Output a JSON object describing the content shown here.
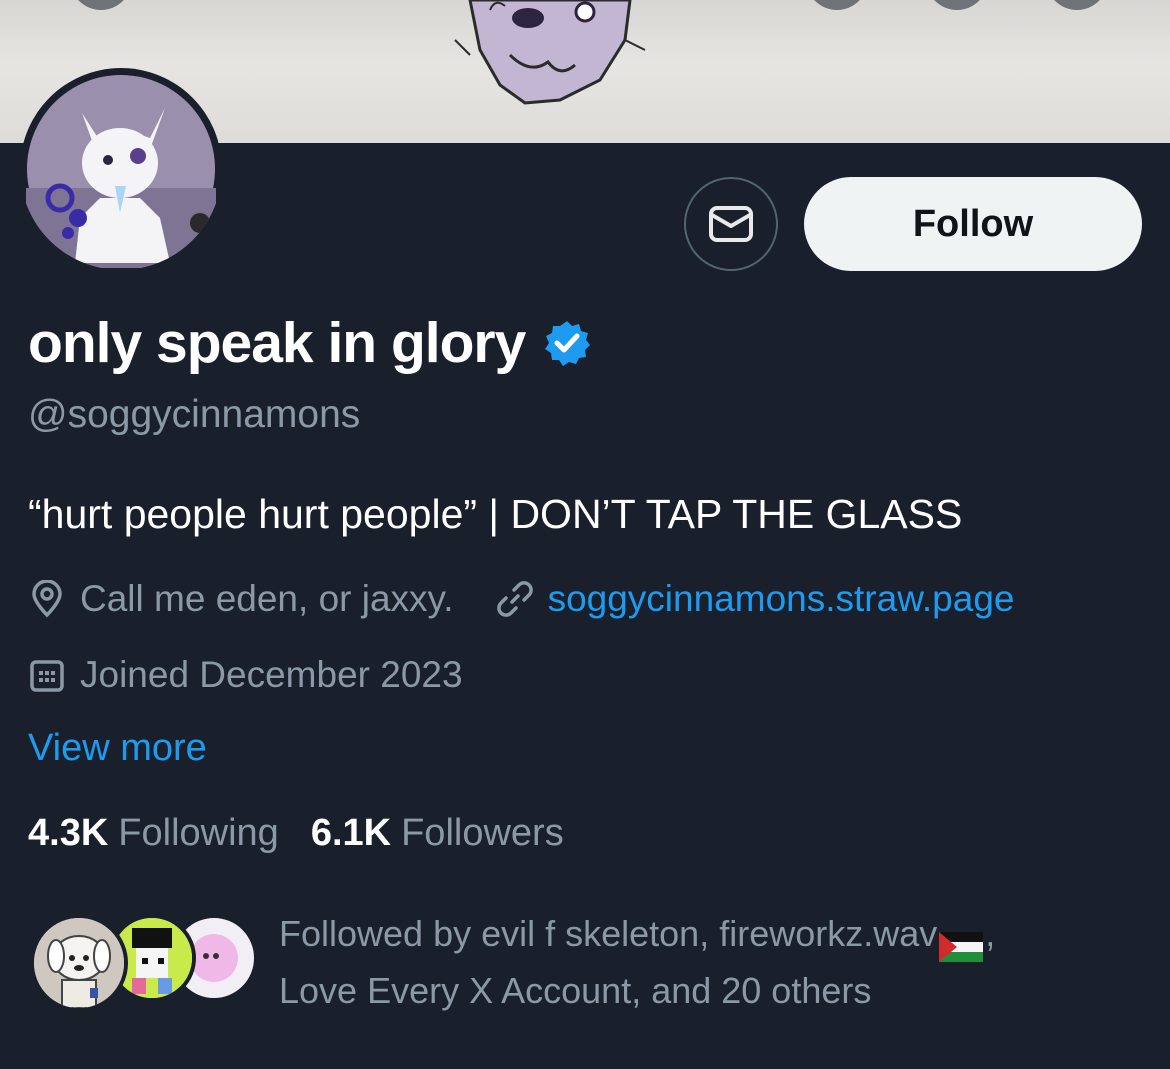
{
  "profile": {
    "display_name": "only speak in glory",
    "handle": "@soggycinnamons",
    "bio": "“hurt people hurt people” | DON’T TAP THE GLASS",
    "location": "Call me eden, or jaxxy.",
    "website": "soggycinnamons.straw.page",
    "joined": "Joined December 2023",
    "view_more": "View more"
  },
  "actions": {
    "follow_label": "Follow",
    "message_icon": "envelope-icon"
  },
  "stats": {
    "following_count": "4.3K",
    "following_label": "Following",
    "followers_count": "6.1K",
    "followers_label": "Followers"
  },
  "followed_by": {
    "line1_prefix": "Followed by evil f skeleton, fireworkz.wav",
    "line1_suffix": ",",
    "line2": "Love Every X Account, and 20 others"
  },
  "icons": {
    "verified": "verified-badge-icon",
    "location": "location-pin-icon",
    "link": "link-icon",
    "calendar": "calendar-icon"
  },
  "colors": {
    "background": "#1a202b",
    "accent": "#1d9bf0",
    "muted_text": "#8b98a5",
    "follow_button_bg": "#eff3f4"
  }
}
